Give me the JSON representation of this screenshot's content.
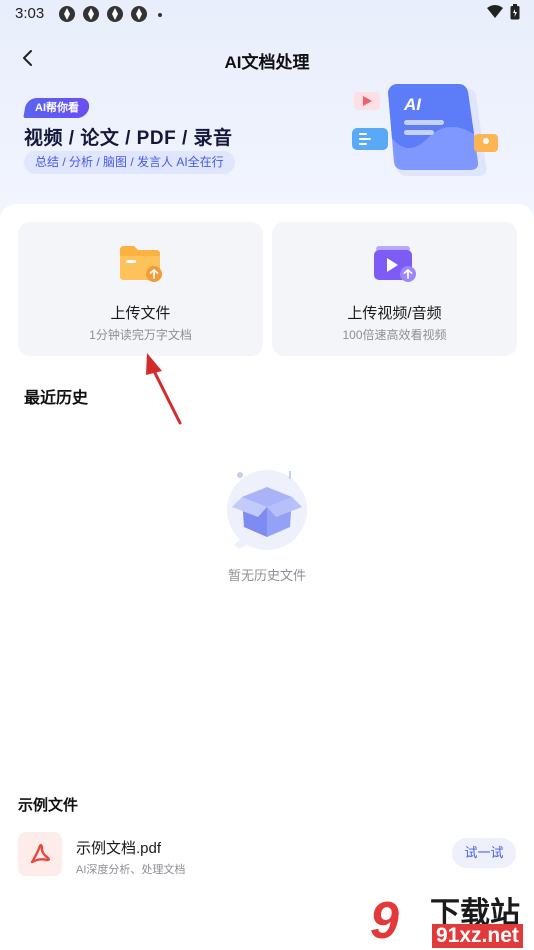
{
  "status_bar": {
    "time": "3:03"
  },
  "header": {
    "title": "AI文档处理"
  },
  "banner": {
    "badge": "AI帮你看",
    "headline": "视频 / 论文 / PDF / 录音",
    "tags": "总结 / 分析 / 脑图 / 发言人  AI全在行",
    "art_label": "AI"
  },
  "upload_cards": [
    {
      "title": "上传文件",
      "subtitle": "1分钟读完万字文档",
      "icon": "folder-upload-icon"
    },
    {
      "title": "上传视频/音频",
      "subtitle": "100倍速高效看视频",
      "icon": "video-upload-icon"
    }
  ],
  "history": {
    "title": "最近历史",
    "empty_text": "暂无历史文件"
  },
  "samples": {
    "title": "示例文件",
    "items": [
      {
        "name": "示例文档.pdf",
        "description": "AI深度分析、处理文档",
        "action": "试一试",
        "icon": "pdf-icon"
      }
    ]
  },
  "watermark": {
    "brand": "下载站",
    "url": "91xz.net",
    "logo": "9"
  },
  "colors": {
    "accent": "#4a59e6",
    "card_bg": "#f4f5f8",
    "pdf": "#e8473c",
    "arrow": "#d42a2a"
  }
}
